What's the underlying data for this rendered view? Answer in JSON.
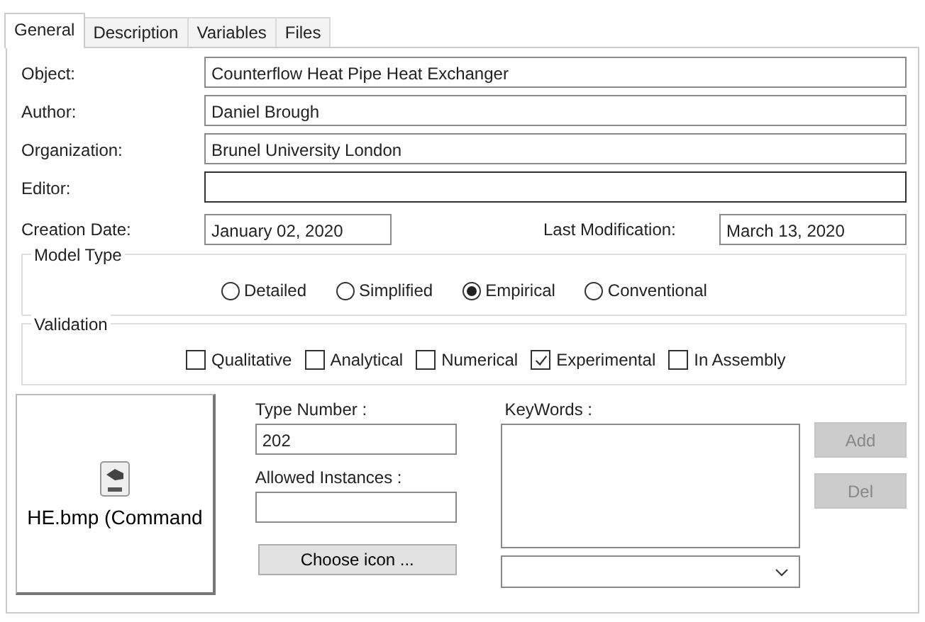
{
  "tabs": [
    {
      "label": "General",
      "selected": true
    },
    {
      "label": "Description",
      "selected": false
    },
    {
      "label": "Variables",
      "selected": false
    },
    {
      "label": "Files",
      "selected": false
    }
  ],
  "fields": [
    {
      "label": "Object:",
      "value": "Counterflow Heat Pipe Heat Exchanger"
    },
    {
      "label": "Author:",
      "value": "Daniel Brough"
    },
    {
      "label": "Organization:",
      "value": "Brunel University London"
    },
    {
      "label": "Editor:",
      "focused": true
    }
  ],
  "creation_date": {
    "label": "Creation Date:",
    "value": "January 02, 2020"
  },
  "last_modification": {
    "label": "Last Modification:",
    "value": "March 13, 2020"
  },
  "model_type": {
    "title": "Model Type",
    "options": [
      {
        "label": "Detailed",
        "selected": false
      },
      {
        "label": "Simplified",
        "selected": false
      },
      {
        "label": "Empirical",
        "selected": true
      },
      {
        "label": "Conventional",
        "selected": false
      }
    ]
  },
  "validation": {
    "title": "Validation",
    "options": [
      {
        "label": "Qualitative",
        "checked": false
      },
      {
        "label": "Analytical",
        "checked": false
      },
      {
        "label": "Numerical",
        "checked": false
      },
      {
        "label": "Experimental",
        "checked": true
      },
      {
        "label": "In Assembly",
        "checked": false
      }
    ]
  },
  "icon_button": {
    "caption": "HE.bmp (Command"
  },
  "type_number": {
    "label": "Type Number :",
    "value": "202"
  },
  "allowed_instances": {
    "label": "Allowed Instances :"
  },
  "choose_icon": {
    "label": "Choose icon ..."
  },
  "keywords": {
    "label": "KeyWords :"
  },
  "buttons": [
    {
      "label": "Add",
      "disabled": true
    },
    {
      "label": "Del",
      "disabled": true
    }
  ]
}
